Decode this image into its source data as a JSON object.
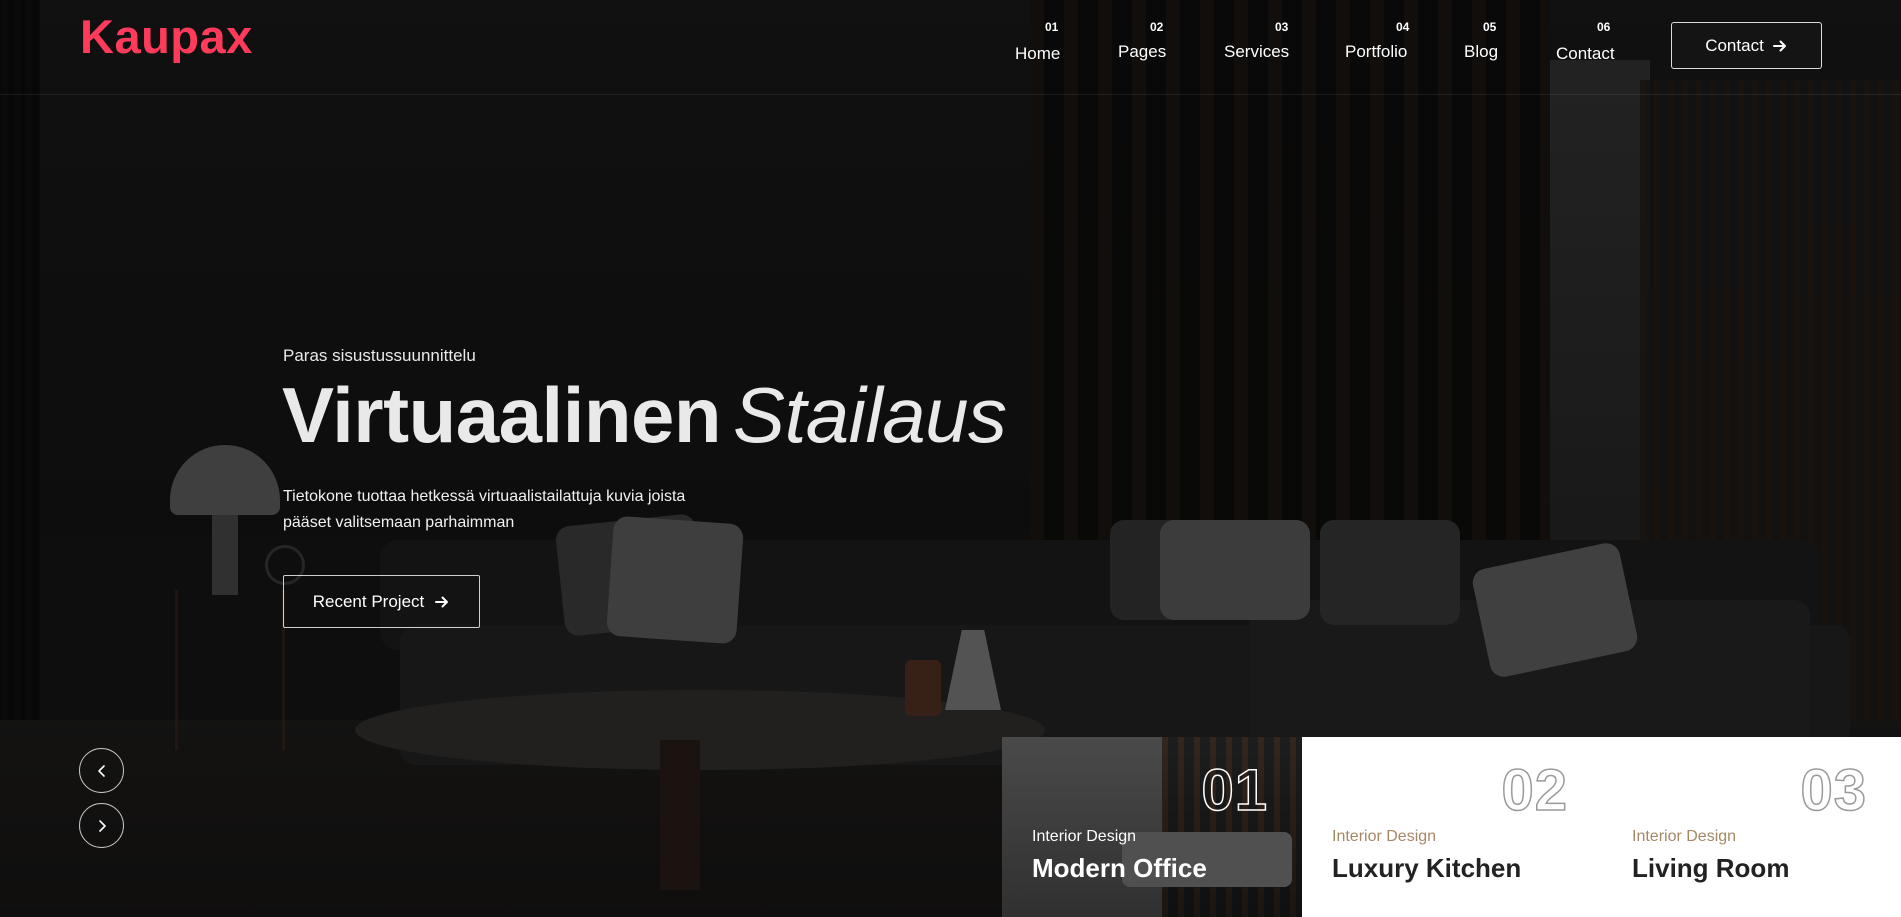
{
  "brand": {
    "logo_text": "Kaupax",
    "accent_color": "#ff3b5c"
  },
  "nav": {
    "items": [
      {
        "number": "01",
        "label": "Home"
      },
      {
        "number": "02",
        "label": "Pages"
      },
      {
        "number": "03",
        "label": "Services"
      },
      {
        "number": "04",
        "label": "Portfolio"
      },
      {
        "number": "05",
        "label": "Blog"
      },
      {
        "number": "06",
        "label": "Contact"
      }
    ],
    "cta_label": "Contact",
    "cta_icon": "arrow-right-icon"
  },
  "hero": {
    "eyebrow": "Paras sisustussuunnittelu",
    "headline_bold": "Virtuaalinen",
    "headline_italic": "Stailaus",
    "description": "Tietokone tuottaa hetkessä virtuaalistailattuja kuvia joista pääset valitsemaan parhaimman",
    "button_label": "Recent Project",
    "button_icon": "arrow-right-icon"
  },
  "slider": {
    "prev_icon": "chevron-left-icon",
    "next_icon": "chevron-right-icon"
  },
  "projects": [
    {
      "number": "01",
      "category": "Interior Design",
      "title": "Modern Office"
    },
    {
      "number": "02",
      "category": "Interior Design",
      "title": "Luxury Kitchen"
    },
    {
      "number": "03",
      "category": "Interior Design",
      "title": "Living Room"
    }
  ]
}
